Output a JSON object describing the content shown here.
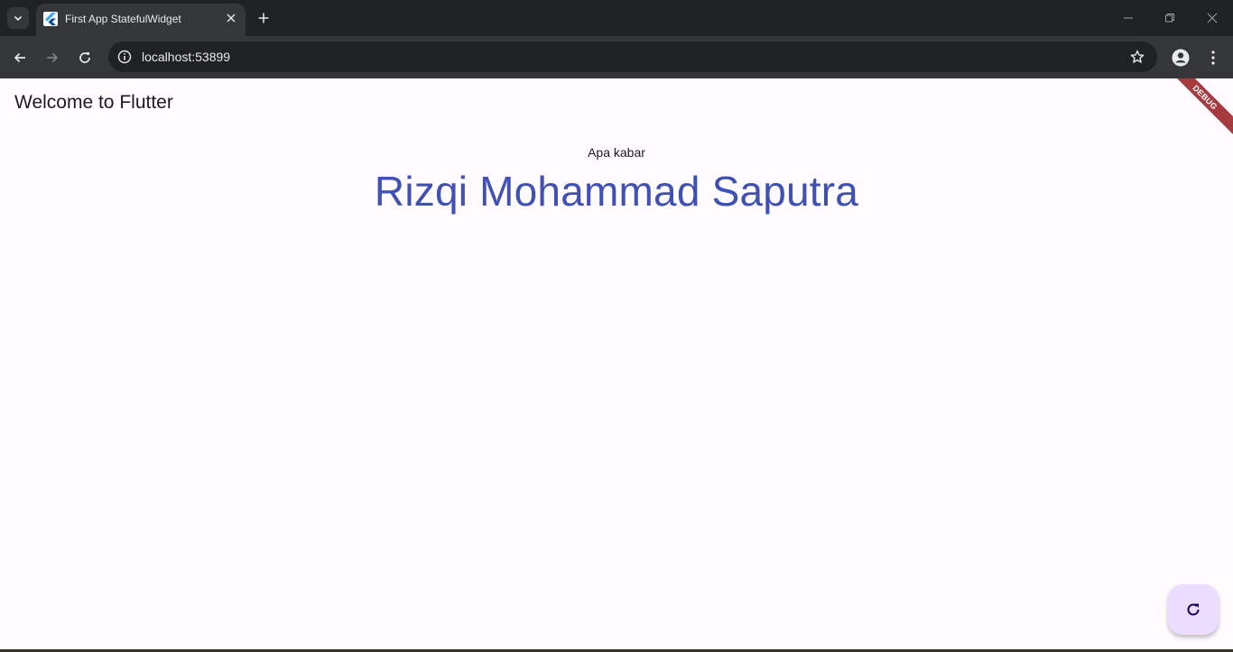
{
  "browser": {
    "tab_title": "First App StatefulWidget",
    "url": "localhost:53899"
  },
  "app": {
    "appbar_title": "Welcome to Flutter",
    "greeting": "Apa kabar",
    "name": "Rizqi Mohammad Saputra",
    "debug_banner": "DEBUG",
    "name_color": "#3f51b5",
    "fab_icon": "refresh-icon"
  },
  "icons": {
    "tab_search": "chevron-down-icon",
    "tab_favicon": "flutter-icon",
    "tab_close": "close-icon",
    "new_tab": "plus-icon",
    "back": "arrow-left-icon",
    "forward": "arrow-right-icon",
    "reload": "reload-icon",
    "site_info": "info-icon",
    "bookmark": "star-icon",
    "profile": "profile-icon",
    "menu": "more-vertical-icon"
  }
}
